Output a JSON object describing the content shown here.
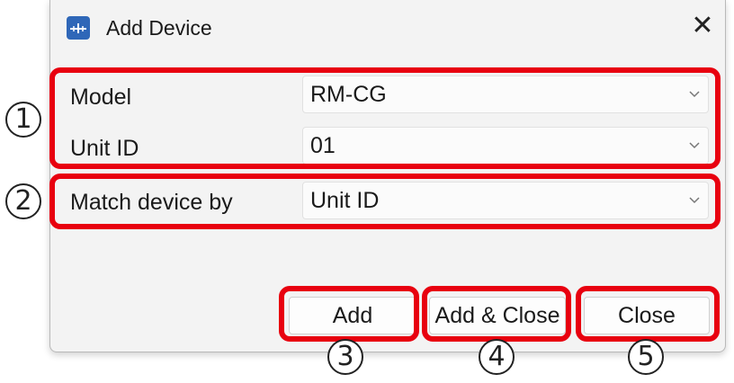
{
  "dialog": {
    "title": "Add Device",
    "app_icon": "device-app-icon",
    "close_glyph": "✕"
  },
  "fields": {
    "model": {
      "label": "Model",
      "value": "RM-CG"
    },
    "unit_id": {
      "label": "Unit ID",
      "value": "01"
    },
    "match_by": {
      "label": "Match device by",
      "value": "Unit ID"
    }
  },
  "buttons": {
    "add": "Add",
    "add_close": "Add & Close",
    "close": "Close"
  },
  "callouts": {
    "one": "1",
    "two": "2",
    "three": "3",
    "four": "4",
    "five": "5"
  },
  "colors": {
    "highlight": "#e8000f",
    "dialog_bg": "#f3f3f3",
    "icon_blue": "#2f67b8"
  }
}
